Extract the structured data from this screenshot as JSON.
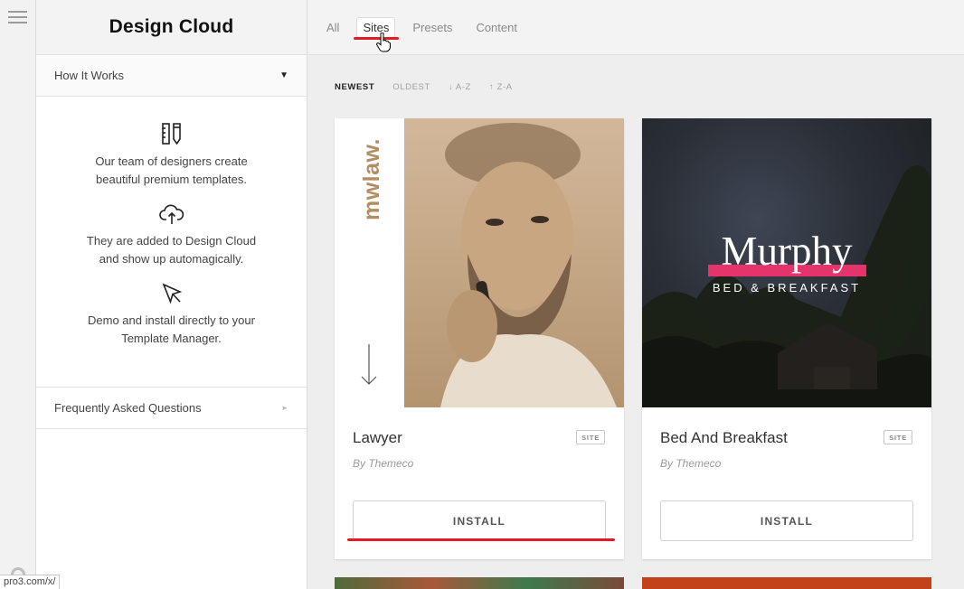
{
  "sidebar": {
    "title": "Design Cloud",
    "how_it_works": {
      "label": "How It Works",
      "caret": "▼"
    },
    "steps": [
      {
        "icon": "ruler-pencil-icon",
        "text": "Our team of designers create beautiful premium templates."
      },
      {
        "icon": "cloud-upload-icon",
        "text": "They are added to Design Cloud and show up automagically."
      },
      {
        "icon": "cursor-arrow-icon",
        "text": "Demo and install directly to your Template Manager."
      }
    ],
    "faq": {
      "label": "Frequently Asked Questions",
      "caret": "►"
    }
  },
  "tabs": [
    {
      "label": "All",
      "active": false
    },
    {
      "label": "Sites",
      "active": true
    },
    {
      "label": "Presets",
      "active": false
    },
    {
      "label": "Content",
      "active": false
    }
  ],
  "sort": [
    {
      "label": "NEWEST",
      "active": true
    },
    {
      "label": "OLDEST",
      "active": false
    },
    {
      "label": "↓ A-Z",
      "active": false
    },
    {
      "label": "↑ Z-A",
      "active": false
    }
  ],
  "cards": [
    {
      "name": "Lawyer",
      "by": "By Themeco",
      "badge": "SITE",
      "install": "INSTALL",
      "thumb_brand": "mwlaw."
    },
    {
      "name": "Bed And Breakfast",
      "by": "By Themeco",
      "badge": "SITE",
      "install": "INSTALL",
      "thumb_title": "Murphy",
      "thumb_subtitle": "BED & BREAKFAST"
    }
  ],
  "status_url": "pro3.com/x/",
  "colors": {
    "accent_red": "#e51b23",
    "murphy_pink": "#e5336b",
    "lawyer_gold": "#b38e62"
  }
}
